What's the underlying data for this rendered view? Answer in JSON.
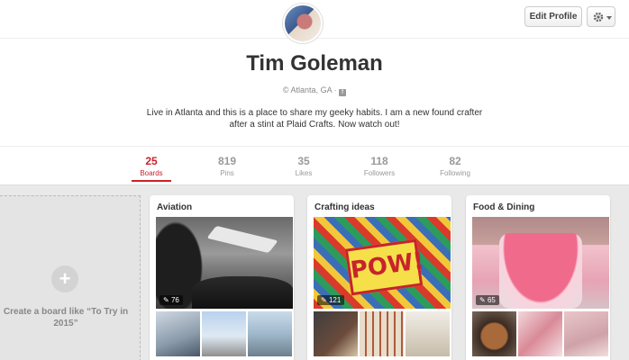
{
  "header": {
    "edit_label": "Edit Profile",
    "settings_icon": "gear-icon"
  },
  "profile": {
    "name": "Tim Goleman",
    "location": "Atlanta, GA",
    "location_icon": "globe-icon",
    "social_icon": "facebook-icon",
    "bio": "Live in Atlanta and this is a place to share my geeky habits. I am a new found crafter after a stint at Plaid Crafts. Now watch out!"
  },
  "stats": [
    {
      "num": "25",
      "label": "Boards",
      "active": true
    },
    {
      "num": "819",
      "label": "Pins"
    },
    {
      "num": "35",
      "label": "Likes"
    },
    {
      "num": "118",
      "label": "Followers"
    },
    {
      "num": "82",
      "label": "Following"
    }
  ],
  "create_board": {
    "plus": "+",
    "text": "Create a board like “To Try in 2015”"
  },
  "boards": [
    {
      "title": "Aviation",
      "pins": "76"
    },
    {
      "title": "Crafting ideas",
      "pins": "121",
      "cover_text": "POW!"
    },
    {
      "title": "Food & Dining",
      "pins": "65"
    }
  ],
  "colors": {
    "accent": "#c8232c",
    "grid_bg": "#e9e9e9"
  }
}
